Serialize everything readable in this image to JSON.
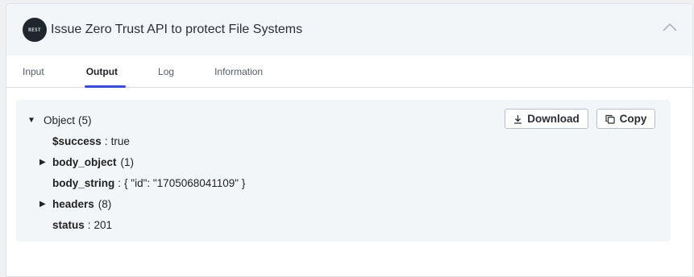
{
  "step": {
    "badge_text": "REST",
    "title": "Issue Zero Trust API to protect File Systems"
  },
  "tabs": [
    {
      "label": "Input"
    },
    {
      "label": "Output"
    },
    {
      "label": "Log"
    },
    {
      "label": "Information"
    }
  ],
  "active_tab": "Output",
  "output": {
    "root_label": "Object",
    "root_count": "(5)",
    "download_label": "Download",
    "copy_label": "Copy",
    "fields": [
      {
        "key": "$success",
        "sep": ":",
        "value": "true"
      },
      {
        "key": "body_object",
        "count": "(1)"
      },
      {
        "key": "body_string",
        "sep": ":",
        "value": "{ \"id\": \"1705068041109\" }"
      },
      {
        "key": "headers",
        "count": "(8)"
      },
      {
        "key": "status",
        "sep": ":",
        "value": "201"
      }
    ]
  },
  "icons": {
    "collapse": "chevron-up-icon",
    "download": "download-icon",
    "copy": "copy-icon",
    "expanded": "caret-down-icon",
    "collapsed": "caret-right-icon"
  },
  "colors": {
    "active_tab_indicator": "#3b4bd6",
    "header_bg": "#f3f6f9",
    "badge_bg": "#20262d"
  }
}
